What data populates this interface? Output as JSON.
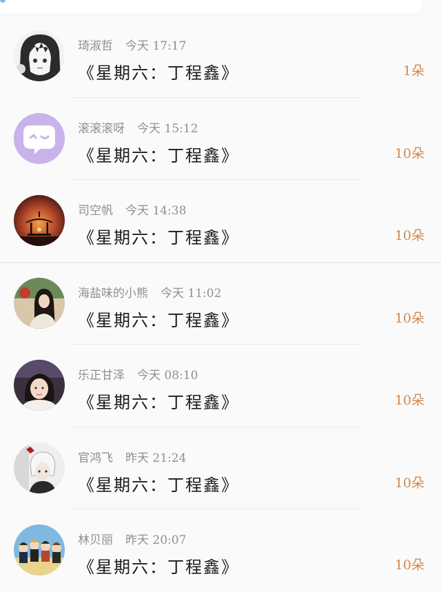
{
  "gifts": [
    {
      "user": "琦淑哲",
      "time": "今天 17:17",
      "book": "《星期六：丁程鑫》",
      "count": "1朵",
      "avatar_icon": "anime-girl-avatar"
    },
    {
      "user": "滚滚滚呀",
      "time": "今天 15:12",
      "book": "《星期六：丁程鑫》",
      "count": "10朵",
      "avatar_icon": "chat-bubble-avatar"
    },
    {
      "user": "司空帆",
      "time": "今天 14:38",
      "book": "《星期六：丁程鑫》",
      "count": "10朵",
      "avatar_icon": "pavilion-sunset-avatar"
    },
    {
      "user": "海盐味的小熊",
      "time": "今天 11:02",
      "book": "《星期六：丁程鑫》",
      "count": "10朵",
      "avatar_icon": "girl-photo-avatar"
    },
    {
      "user": "乐正甘泽",
      "time": "今天 08:10",
      "book": "《星期六：丁程鑫》",
      "count": "10朵",
      "avatar_icon": "portrait-photo-avatar"
    },
    {
      "user": "官鸿飞",
      "time": "昨天 21:24",
      "book": "《星期六：丁程鑫》",
      "count": "10朵",
      "avatar_icon": "anime-boy-avatar"
    },
    {
      "user": "林贝丽",
      "time": "昨天 20:07",
      "book": "《星期六：丁程鑫》",
      "count": "10朵",
      "avatar_icon": "group-cartoon-avatar"
    }
  ],
  "colors": {
    "count": "#d3884c",
    "username": "#8f8f8f",
    "book_title": "#1d1d1d",
    "chat_avatar_bg": "#c9b3ea"
  }
}
